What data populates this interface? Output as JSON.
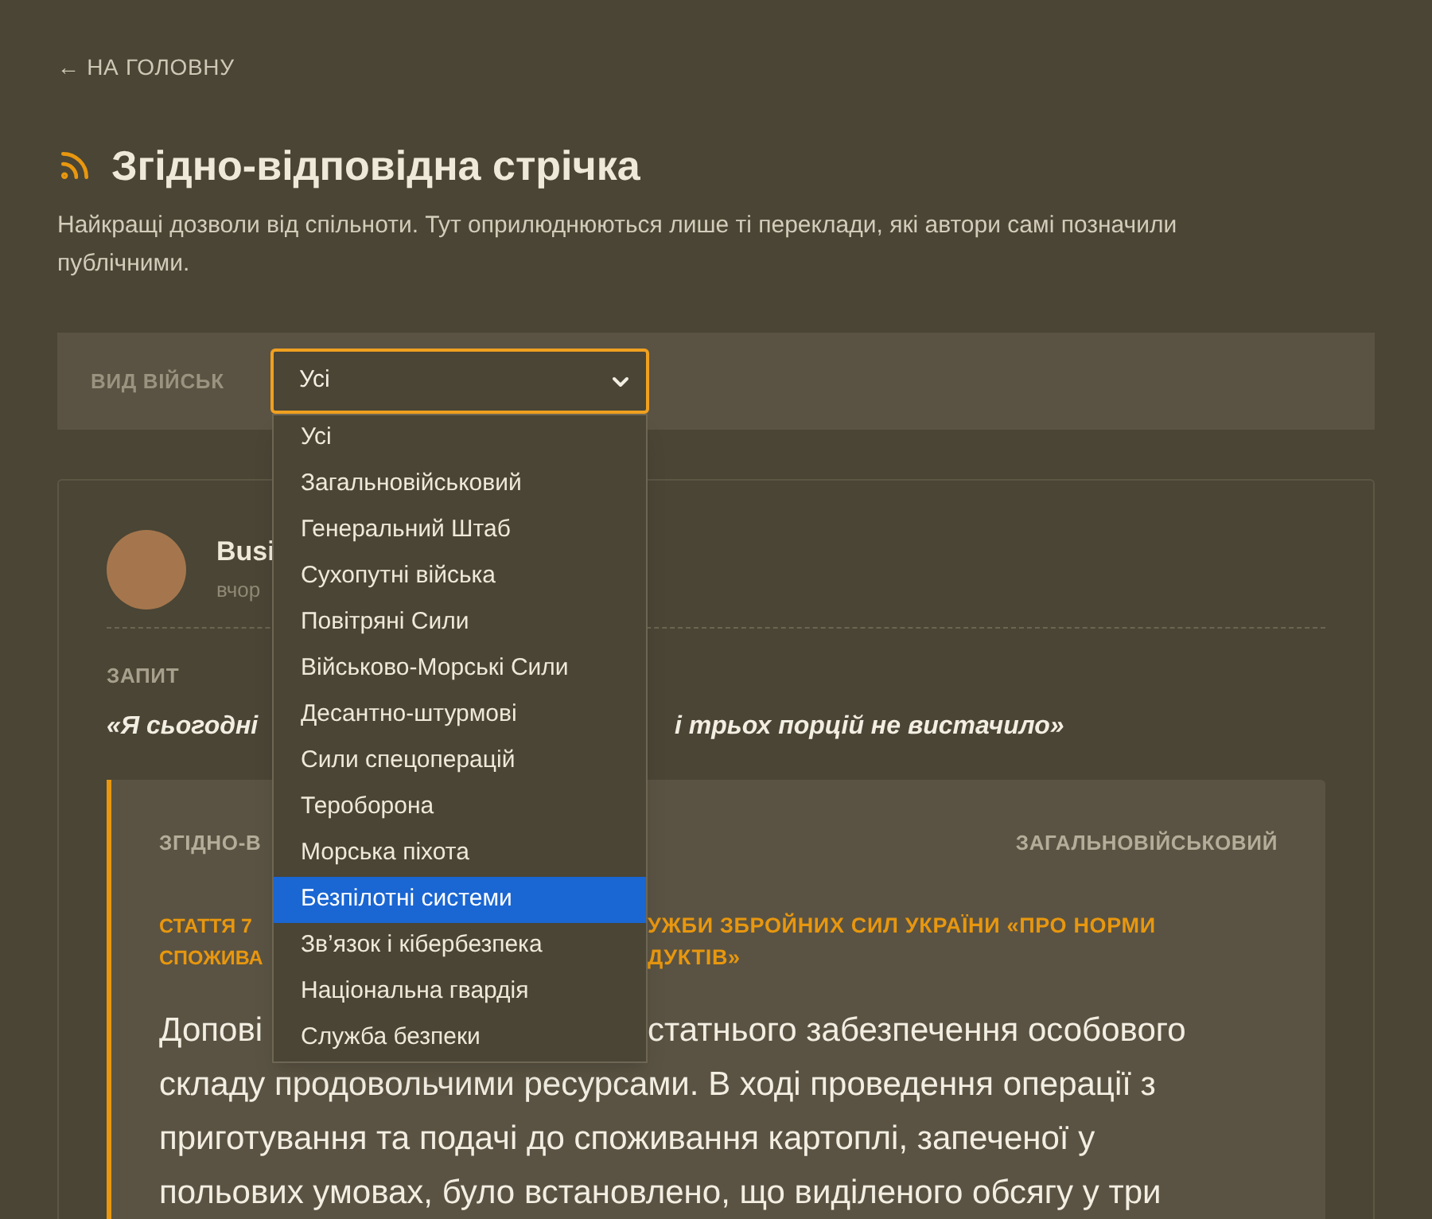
{
  "back_link": "← НА ГОЛОВНУ",
  "title": "Згідно-відповідна стрічка",
  "description": "Найкращі дозволи від спільноти. Тут оприлюднюються лише ті переклади, які автори самі позначили публічними.",
  "filter": {
    "label": "ВИД ВІЙСЬК",
    "value": "Усі",
    "expanded": true,
    "options": [
      {
        "label": "Усі",
        "highlighted": false
      },
      {
        "label": "Загальновійськовий",
        "highlighted": false
      },
      {
        "label": "Генеральний Штаб",
        "highlighted": false
      },
      {
        "label": "Сухопутні війська",
        "highlighted": false
      },
      {
        "label": "Повітряні Сили",
        "highlighted": false
      },
      {
        "label": "Військово-Морські Сили",
        "highlighted": false
      },
      {
        "label": "Десантно-штурмові",
        "highlighted": false
      },
      {
        "label": "Сили спецоперацій",
        "highlighted": false
      },
      {
        "label": "Тероборона",
        "highlighted": false
      },
      {
        "label": "Морська піхота",
        "highlighted": false
      },
      {
        "label": "Безпілотні системи",
        "highlighted": true
      },
      {
        "label": "Зв’язок і кібербезпека",
        "highlighted": false
      },
      {
        "label": "Національна гвардія",
        "highlighted": false
      },
      {
        "label": "Служба безпеки",
        "highlighted": false
      }
    ]
  },
  "post": {
    "author": "Busi",
    "time": "вчор",
    "request_label": "ЗАПИТ",
    "request_start": "«Я сьогодні",
    "request_end": "і трьох порцій не вистачило»",
    "answer": {
      "label": "ЗГІДНО-В",
      "branch": "ЗАГАЛЬНОВІЙСЬКОВИЙ",
      "article_left": [
        "СТАТТЯ 7",
        "СПОЖИВА"
      ],
      "article_right": [
        "УЖБИ ЗБРОЙНИХ СИЛ УКРАЇНИ «ПРО НОРМИ",
        "ДУКТІВ»"
      ],
      "body_first_left": "Допові",
      "body_first_right": "статнього забезпечення особового",
      "body_lines": [
        "складу продовольчими ресурсами. В ході проведення операції з",
        "приготування та подачі до споживання картоплі, запеченої у",
        "польових умовах, було встановлено, що виділеного обсягу у три"
      ]
    }
  }
}
